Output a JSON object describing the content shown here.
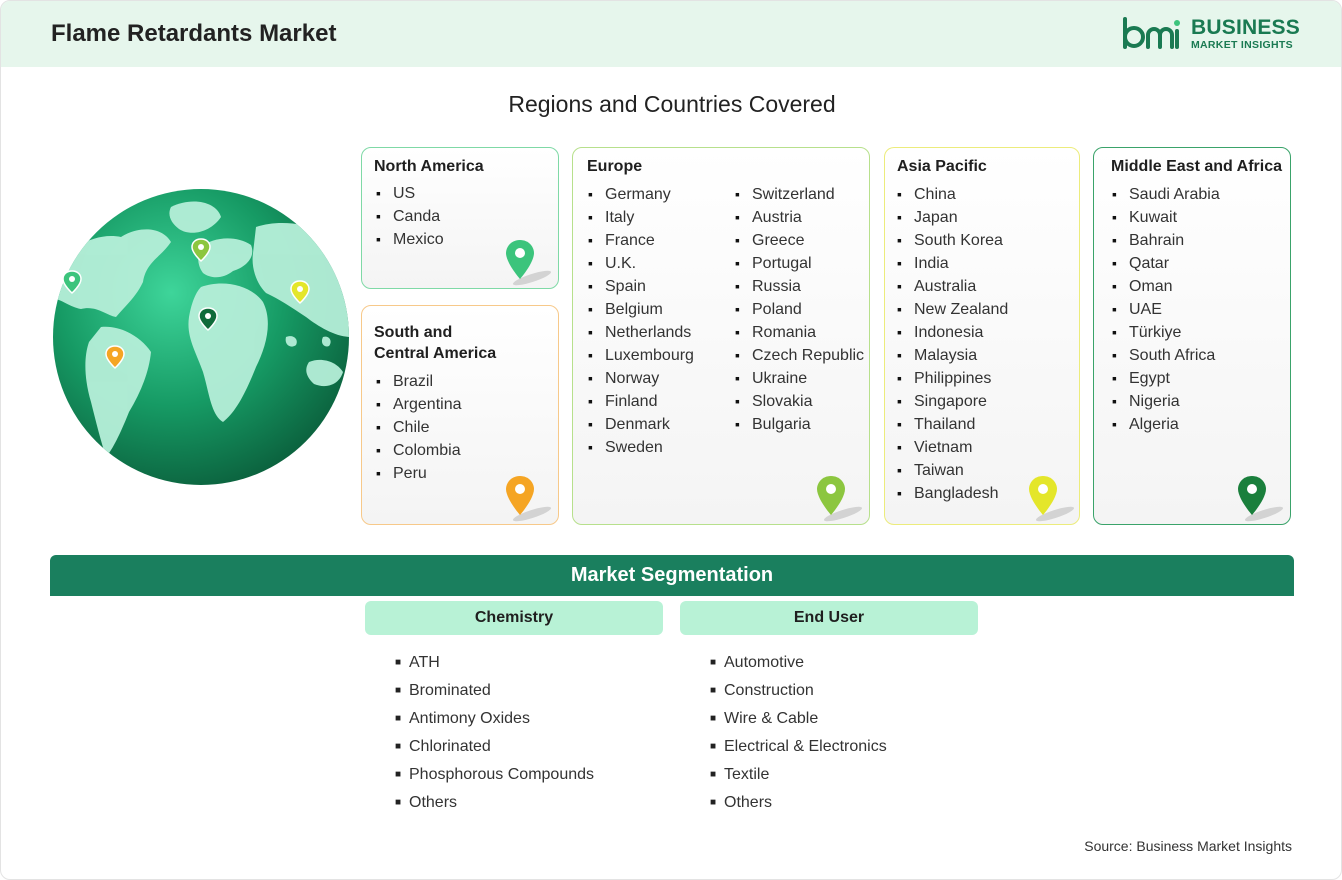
{
  "header": {
    "title": "Flame Retardants Market"
  },
  "logo": {
    "line1": "BUSINESS",
    "line2": "MARKET INSIGHTS",
    "brand_color": "#1a7a52"
  },
  "regions_title": "Regions and Countries Covered",
  "regions": {
    "north_america": {
      "title": "North America",
      "countries": [
        "US",
        "Canda",
        "Mexico"
      ],
      "pin_color": "#3cc47c"
    },
    "south_central_america": {
      "title_line1": "South and",
      "title_line2": "Central America",
      "countries": [
        "Brazil",
        "Argentina",
        "Chile",
        "Colombia",
        "Peru"
      ],
      "pin_color": "#f5a524"
    },
    "europe": {
      "title": "Europe",
      "countries_col1": [
        "Germany",
        "Italy",
        "France",
        "U.K.",
        "Spain",
        "Belgium",
        "Netherlands",
        "Luxembourg",
        "Norway",
        "Finland",
        "Denmark",
        "Sweden"
      ],
      "countries_col2": [
        "Switzerland",
        "Austria",
        "Greece",
        "Portugal",
        "Russia",
        "Poland",
        "Romania",
        "Czech Republic",
        "Ukraine",
        "Slovakia",
        "Bulgaria"
      ],
      "pin_color": "#8cc63f"
    },
    "asia_pacific": {
      "title": "Asia Pacific",
      "countries": [
        "China",
        "Japan",
        "South Korea",
        "India",
        "Australia",
        "New Zealand",
        "Indonesia",
        "Malaysia",
        "Philippines",
        "Singapore",
        "Thailand",
        "Vietnam",
        "Taiwan",
        "Bangladesh"
      ],
      "pin_color": "#e4e62a"
    },
    "middle_east_africa": {
      "title": "Middle East and Africa",
      "countries": [
        "Saudi Arabia",
        "Kuwait",
        "Bahrain",
        "Qatar",
        "Oman",
        "UAE",
        "Türkiye",
        "South Africa",
        "Egypt",
        "Nigeria",
        "Algeria"
      ],
      "pin_color": "#1a7f3c"
    }
  },
  "segmentation": {
    "title": "Market Segmentation",
    "chemistry": {
      "title": "Chemistry",
      "items": [
        "ATH",
        "Brominated",
        "Antimony Oxides",
        "Chlorinated",
        "Phosphorous Compounds",
        "Others"
      ]
    },
    "end_user": {
      "title": "End User",
      "items": [
        "Automotive",
        "Construction",
        "Wire & Cable",
        "Electrical & Electronics",
        "Textile",
        "Others"
      ]
    }
  },
  "source": "Source: Business Market Insights"
}
